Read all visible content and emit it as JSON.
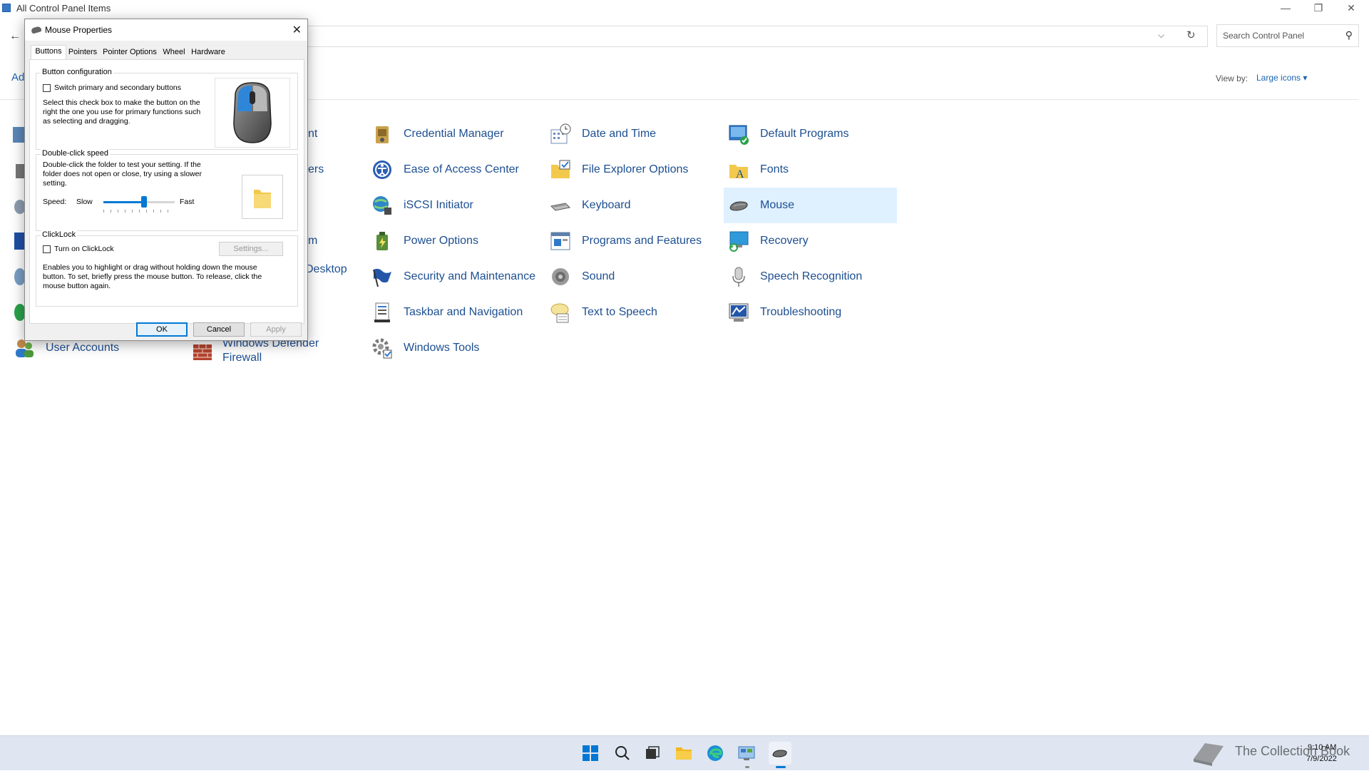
{
  "window": {
    "title": "All Control Panel Items",
    "minimize_glyph": "—",
    "restore_glyph": "❐",
    "close_glyph": "✕"
  },
  "nav": {
    "back_glyph": "←",
    "dropdown_glyph": "⌵",
    "refresh_glyph": "↻",
    "search_placeholder": "Search Control Panel",
    "search_glyph": "⚲"
  },
  "header": {
    "partial_heading": "Ad",
    "view_by_label": "View by:",
    "view_by_value": "Large icons ▾"
  },
  "items": [
    {
      "label": "nt",
      "icon": "administrative-tools-icon"
    },
    {
      "label": "ers",
      "icon": "devices-printers-icon"
    },
    {
      "label": "m",
      "icon": "system-icon"
    },
    {
      "label": "Desktop",
      "icon": "remote-desktop-icon"
    },
    {
      "label": "User Accounts",
      "icon": "user-accounts-icon"
    },
    {
      "label": "Windows Defender",
      "label2": "Firewall",
      "icon": "firewall-icon"
    },
    {
      "label": "Credential Manager",
      "icon": "credential-manager-icon"
    },
    {
      "label": "Ease of Access Center",
      "icon": "ease-of-access-icon"
    },
    {
      "label": "iSCSI Initiator",
      "icon": "iscsi-icon"
    },
    {
      "label": "Power Options",
      "icon": "power-options-icon"
    },
    {
      "label": "Security and Maintenance",
      "icon": "security-flag-icon"
    },
    {
      "label": "Taskbar and Navigation",
      "icon": "taskbar-icon"
    },
    {
      "label": "Windows Tools",
      "icon": "windows-tools-icon"
    },
    {
      "label": "Date and Time",
      "icon": "date-time-icon"
    },
    {
      "label": "File Explorer Options",
      "icon": "folder-options-icon"
    },
    {
      "label": "Keyboard",
      "icon": "keyboard-icon"
    },
    {
      "label": "Programs and Features",
      "icon": "programs-features-icon"
    },
    {
      "label": "Sound",
      "icon": "sound-icon"
    },
    {
      "label": "Text to Speech",
      "icon": "text-to-speech-icon"
    },
    {
      "label": "Default Programs",
      "icon": "default-programs-icon"
    },
    {
      "label": "Fonts",
      "icon": "fonts-icon"
    },
    {
      "label": "Mouse",
      "icon": "mouse-icon"
    },
    {
      "label": "Recovery",
      "icon": "recovery-icon"
    },
    {
      "label": "Speech Recognition",
      "icon": "microphone-icon"
    },
    {
      "label": "Troubleshooting",
      "icon": "troubleshooting-icon"
    }
  ],
  "dialog": {
    "title": "Mouse Properties",
    "close_glyph": "✕",
    "tabs": [
      "Buttons",
      "Pointers",
      "Pointer Options",
      "Wheel",
      "Hardware"
    ],
    "active_tab": "Buttons",
    "button_config": {
      "label": "Button configuration",
      "checkbox_label": "Switch primary and secondary buttons",
      "checked": false,
      "desc1": "Select this check box to make the button on the",
      "desc2": "right the one you use for primary functions such",
      "desc3": "as selecting and dragging."
    },
    "double_click": {
      "label": "Double-click speed",
      "desc1": "Double-click the folder to test your setting. If the",
      "desc2": "folder does not open or close, try using a slower",
      "desc3": "setting.",
      "speed_label": "Speed:",
      "slow_label": "Slow",
      "fast_label": "Fast",
      "speed_fraction": 0.58
    },
    "clicklock": {
      "label": "ClickLock",
      "checkbox_label": "Turn on ClickLock",
      "checked": false,
      "settings_button": "Settings...",
      "desc1": "Enables you to highlight or drag without holding down the mouse",
      "desc2": "button. To set, briefly press the mouse button. To release, click the",
      "desc3": "mouse button again."
    },
    "buttons": {
      "ok": "OK",
      "cancel": "Cancel",
      "apply": "Apply"
    }
  },
  "taskbar": {
    "time": "9:10 AM",
    "date": "7/9/2022",
    "watermark": "The Collection Book"
  },
  "colors": {
    "accent": "#0078d4",
    "link": "#1d4f91",
    "selected": "#dff0ff"
  }
}
